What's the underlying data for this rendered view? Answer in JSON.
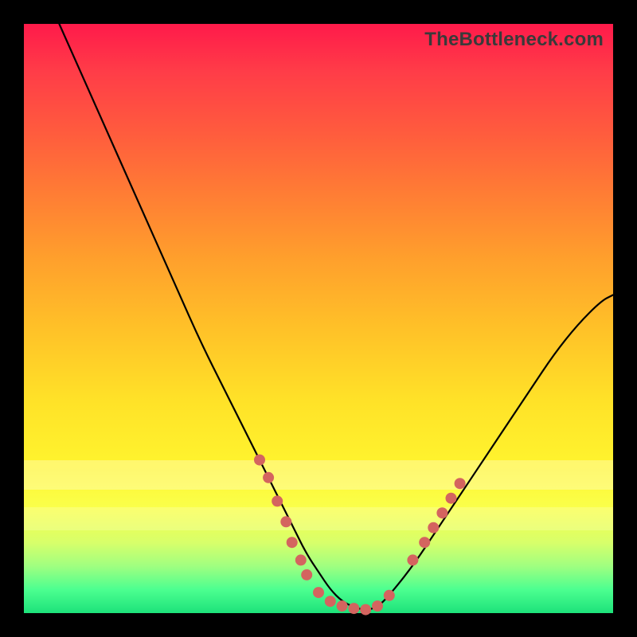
{
  "watermark": "TheBottleneck.com",
  "chart_data": {
    "type": "line",
    "title": "",
    "xlabel": "",
    "ylabel": "",
    "xlim": [
      0,
      100
    ],
    "ylim": [
      0,
      100
    ],
    "grid": false,
    "series": [
      {
        "name": "bottleneck-curve",
        "x": [
          6,
          10,
          14,
          18,
          22,
          26,
          30,
          34,
          38,
          40,
          42,
          44,
          46,
          48,
          50,
          52,
          54,
          56,
          58,
          60,
          62,
          66,
          70,
          74,
          78,
          82,
          86,
          90,
          94,
          98,
          100
        ],
        "y": [
          100,
          91,
          82,
          73,
          64,
          55,
          46,
          38,
          30,
          26,
          22,
          18,
          14,
          10,
          7,
          4,
          2,
          1,
          0.5,
          1,
          3,
          8,
          14,
          20,
          26,
          32,
          38,
          44,
          49,
          53,
          54
        ]
      }
    ],
    "markers": {
      "name": "highlight-dots",
      "points": [
        {
          "x": 40,
          "y": 26
        },
        {
          "x": 41.5,
          "y": 23
        },
        {
          "x": 43,
          "y": 19
        },
        {
          "x": 44.5,
          "y": 15.5
        },
        {
          "x": 45.5,
          "y": 12
        },
        {
          "x": 47,
          "y": 9
        },
        {
          "x": 48,
          "y": 6.5
        },
        {
          "x": 50,
          "y": 3.5
        },
        {
          "x": 52,
          "y": 2
        },
        {
          "x": 54,
          "y": 1.2
        },
        {
          "x": 56,
          "y": 0.8
        },
        {
          "x": 58,
          "y": 0.6
        },
        {
          "x": 60,
          "y": 1.2
        },
        {
          "x": 62,
          "y": 3
        },
        {
          "x": 66,
          "y": 9
        },
        {
          "x": 68,
          "y": 12
        },
        {
          "x": 69.5,
          "y": 14.5
        },
        {
          "x": 71,
          "y": 17
        },
        {
          "x": 72.5,
          "y": 19.5
        },
        {
          "x": 74,
          "y": 22
        }
      ],
      "radius": 7
    },
    "gradient_stops": [
      {
        "pos": 0.0,
        "color": "#ff1a4a"
      },
      {
        "pos": 0.25,
        "color": "#ff7a35"
      },
      {
        "pos": 0.55,
        "color": "#ffd628"
      },
      {
        "pos": 0.8,
        "color": "#f5ff40"
      },
      {
        "pos": 1.0,
        "color": "#1de27a"
      }
    ]
  }
}
